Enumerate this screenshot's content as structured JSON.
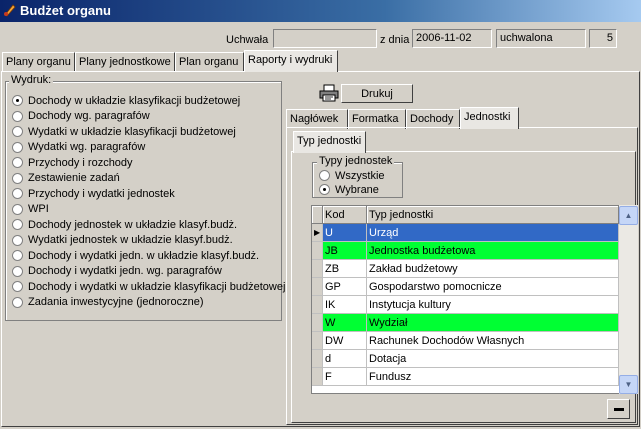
{
  "window": {
    "title": "Budżet organu"
  },
  "header": {
    "uchwala_label": "Uchwała",
    "uchwala_value": "",
    "date_label": "z dnia",
    "date_value": "2006-11-02",
    "status_value": "uchwalona",
    "number_value": "5"
  },
  "main_tabs": [
    "Plany organu",
    "Plany jednostkowe",
    "Plan organu",
    "Raporty i wydruki"
  ],
  "wydruk": {
    "legend": "Wydruk:",
    "selected_index": 0,
    "items": [
      "Dochody w układzie klasyfikacji budżetowej",
      "Dochody wg. paragrafów",
      "Wydatki w układzie klasyfikacji budżetowej",
      "Wydatki wg. paragrafów",
      "Przychody i rozchody",
      "Zestawienie zadań",
      "Przychody i wydatki jednostek",
      "WPI",
      "Dochody jednostek w układzie klasyf.budż.",
      "Wydatki jednostek w układzie klasyf.budż.",
      "Dochody i wydatki jedn. w układzie klasyf.budż.",
      "Dochody i wydatki jedn. wg. paragrafów",
      "Dochody i wydatki w układzie klasyfikacji budżetowej",
      "Zadania inwestycyjne (jednoroczne)"
    ]
  },
  "print_button": {
    "label": "Drukuj"
  },
  "sub_tabs": [
    "Nagłówek",
    "Formatka",
    "Dochody",
    "Jednostki"
  ],
  "inner_tab": "Typ jednostki",
  "typy": {
    "legend": "Typy jednostek",
    "options": [
      "Wszystkie",
      "Wybrane"
    ],
    "selected_index": 1
  },
  "grid": {
    "columns": [
      "Kod",
      "Typ jednostki"
    ],
    "rows": [
      {
        "kod": "U",
        "typ": "Urząd",
        "state": "selected"
      },
      {
        "kod": "JB",
        "typ": "Jednostka budżetowa",
        "state": "green"
      },
      {
        "kod": "ZB",
        "typ": "Zakład budżetowy",
        "state": ""
      },
      {
        "kod": "GP",
        "typ": "Gospodarstwo pomocnicze",
        "state": ""
      },
      {
        "kod": "IK",
        "typ": "Instytucja kultury",
        "state": ""
      },
      {
        "kod": "W",
        "typ": "Wydział",
        "state": "green"
      },
      {
        "kod": "DW",
        "typ": "Rachunek Dochodów Własnych",
        "state": ""
      },
      {
        "kod": "d",
        "typ": "Dotacja",
        "state": ""
      },
      {
        "kod": "F",
        "typ": "Fundusz",
        "state": ""
      }
    ]
  },
  "colors": {
    "selected": "#3169c6",
    "highlight": "#00ff33"
  }
}
